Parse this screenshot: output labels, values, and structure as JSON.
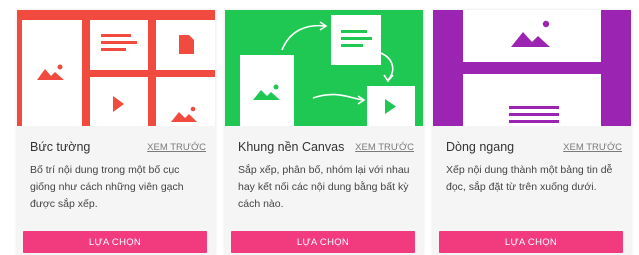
{
  "colors": {
    "accent": "#f23b7e",
    "card1": "#f04b3e",
    "card2": "#1fc753",
    "card3": "#9b25b2"
  },
  "cards": [
    {
      "title": "Bức tường",
      "preview": "XEM TRƯỚC",
      "description": "Bố trí nội dung trong một bố cục giống như cách những viên gạch được sắp xếp.",
      "button": "LỰA CHỌN",
      "thumbnail_icons": [
        "image-icon",
        "text-icon",
        "document-icon",
        "play-icon",
        "image-icon"
      ]
    },
    {
      "title": "Khung nền Canvas",
      "preview": "XEM TRƯỚC",
      "description": "Sắp xếp, phân bố, nhóm lại với nhau hay kết nối các nội dung bằng bất kỳ cách nào.",
      "button": "LỰA CHỌN",
      "thumbnail_icons": [
        "image-icon",
        "text-icon",
        "play-icon",
        "arrow-icon"
      ]
    },
    {
      "title": "Dòng ngang",
      "preview": "XEM TRƯỚC",
      "description": "Xếp nội dung thành một bảng tin dễ đọc, sắp đặt từ trên xuống dưới.",
      "button": "LỰA CHỌN",
      "thumbnail_icons": [
        "image-icon",
        "text-icon"
      ]
    }
  ]
}
